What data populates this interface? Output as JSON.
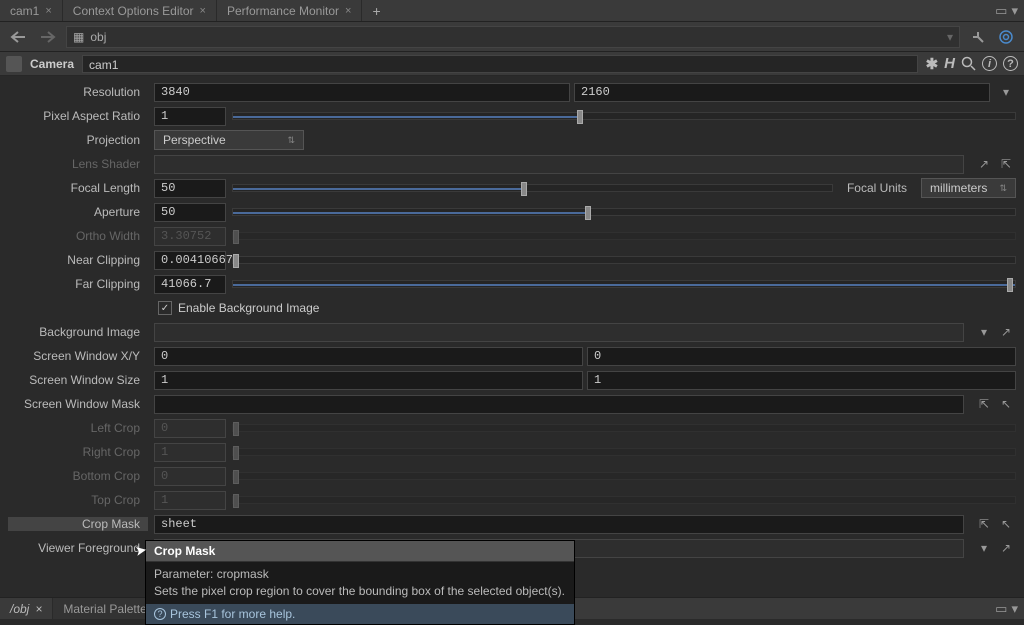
{
  "topTabs": [
    {
      "label": "cam1"
    },
    {
      "label": "Context Options Editor"
    },
    {
      "label": "Performance Monitor"
    }
  ],
  "path": {
    "text": "obj"
  },
  "header": {
    "type": "Camera",
    "name": "cam1"
  },
  "params": {
    "resolution": {
      "label": "Resolution",
      "x": "3840",
      "y": "2160"
    },
    "pixelAspect": {
      "label": "Pixel Aspect Ratio",
      "value": "1",
      "slider": 44
    },
    "projection": {
      "label": "Projection",
      "value": "Perspective"
    },
    "lensShader": {
      "label": "Lens Shader"
    },
    "focalLength": {
      "label": "Focal Length",
      "value": "50",
      "slider": 48,
      "unitsLabel": "Focal Units",
      "units": "millimeters"
    },
    "aperture": {
      "label": "Aperture",
      "value": "50",
      "slider": 45
    },
    "orthoWidth": {
      "label": "Ortho Width",
      "value": "3.30752"
    },
    "nearClip": {
      "label": "Near Clipping",
      "value": "0.00410667",
      "slider": 0
    },
    "farClip": {
      "label": "Far Clipping",
      "value": "41066.7",
      "slider": 100
    },
    "enableBg": {
      "label": "Enable Background Image",
      "checked": true
    },
    "bgImage": {
      "label": "Background Image"
    },
    "screenWinXY": {
      "label": "Screen Window X/Y",
      "x": "0",
      "y": "0"
    },
    "screenWinSize": {
      "label": "Screen Window Size",
      "x": "1",
      "y": "1"
    },
    "screenWinMask": {
      "label": "Screen Window Mask"
    },
    "leftCrop": {
      "label": "Left Crop",
      "value": "0"
    },
    "rightCrop": {
      "label": "Right Crop",
      "value": "1"
    },
    "bottomCrop": {
      "label": "Bottom Crop",
      "value": "0"
    },
    "topCrop": {
      "label": "Top Crop",
      "value": "1"
    },
    "cropMask": {
      "label": "Crop Mask",
      "value": "sheet"
    },
    "viewerFg": {
      "label": "Viewer Foreground"
    }
  },
  "tooltip": {
    "title": "Crop Mask",
    "param": "Parameter: cropmask",
    "desc": "Sets the pixel crop region to cover the bounding box of the selected object(s).",
    "help": "Press F1 for more help."
  },
  "bottomTabs": [
    {
      "label": "/obj"
    },
    {
      "label": "Material Palette"
    }
  ]
}
